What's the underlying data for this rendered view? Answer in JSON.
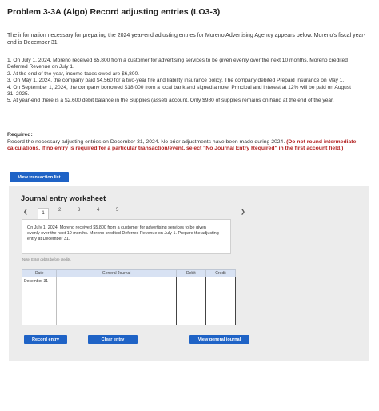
{
  "problem": {
    "title": "Problem 3-3A (Algo) Record adjusting entries (LO3-3)",
    "intro": "The information necessary for preparing the 2024 year-end adjusting entries for Moreno Advertising Agency appears below. Moreno's fiscal year-end is December 31.",
    "items": [
      "1. On July 1, 2024, Moreno received $5,800 from a customer for advertising services to be given evenly over the next 10 months. Moreno credited Deferred Revenue on July 1.",
      "2. At the end of the year, income taxes owed are $6,800.",
      "3. On May 1, 2024, the company paid $4,560 for a two-year fire and liability insurance policy. The company debited Prepaid Insurance on May 1.",
      "4. On September 1, 2024, the company borrowed $18,000 from a local bank and signed a note. Principal and interest at 12% will be paid on August 31, 2025.",
      "5. At year-end there is a $2,600 debit balance in the Supplies (asset) account. Only $980 of supplies remains on hand at the end of the year."
    ],
    "required_label": "Required:",
    "required_text": "Record the necessary adjusting entries on December 31, 2024. No prior adjustments have been made during 2024.",
    "required_highlight": "(Do not round intermediate calculations. If no entry is required for a particular transaction/event, select \"No Journal Entry Required\" in the first account field.)"
  },
  "buttons": {
    "view_transaction_list": "View transaction list",
    "record_entry": "Record entry",
    "clear_entry": "Clear entry",
    "view_general_journal": "View general journal"
  },
  "worksheet": {
    "title": "Journal entry worksheet",
    "pages": [
      "1",
      "2",
      "3",
      "4",
      "5"
    ],
    "active_page": "1",
    "prev_icon": "chevron-left-icon",
    "next_icon": "chevron-right-icon",
    "description": "On July 1, 2024, Moreno received $5,800 from a customer for advertising services to be given evenly over the next 10 months. Moreno credited Deferred Revenue on July 1. Prepare the adjusting entry at December 31.",
    "note": "Note: Enter debits before credits.",
    "table": {
      "headers": [
        "Date",
        "General Journal",
        "Debit",
        "Credit"
      ],
      "first_date": "December 31"
    }
  },
  "colors": {
    "button_blue": "#1f63c6",
    "required_red": "#b22222",
    "header_blue": "#d8e2f3",
    "panel_gray": "#ececec"
  }
}
